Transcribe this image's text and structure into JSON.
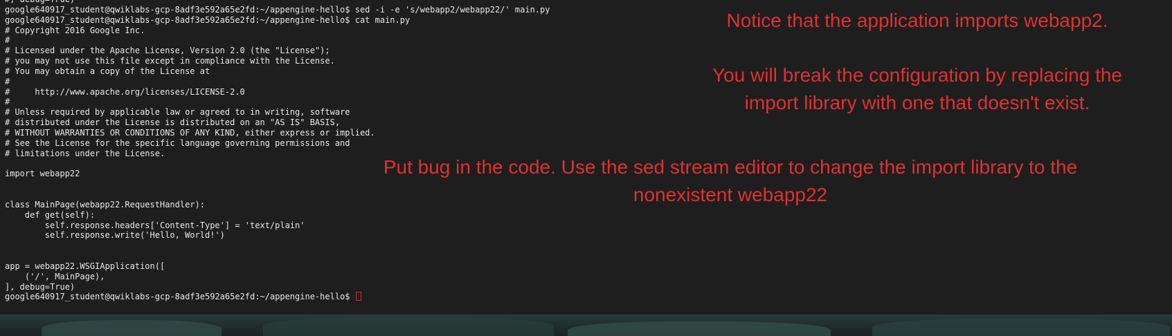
{
  "terminal": {
    "lines": [
      "#, debug=True)",
      "google640917_student@qwiklabs-gcp-8adf3e592a65e2fd:~/appengine-hello$ sed -i -e 's/webapp2/webapp22/' main.py",
      "google640917_student@qwiklabs-gcp-8adf3e592a65e2fd:~/appengine-hello$ cat main.py",
      "# Copyright 2016 Google Inc.",
      "#",
      "# Licensed under the Apache License, Version 2.0 (the \"License\");",
      "# you may not use this file except in compliance with the License.",
      "# You may obtain a copy of the License at",
      "#",
      "#     http://www.apache.org/licenses/LICENSE-2.0",
      "#",
      "# Unless required by applicable law or agreed to in writing, software",
      "# distributed under the License is distributed on an \"AS IS\" BASIS,",
      "# WITHOUT WARRANTIES OR CONDITIONS OF ANY KIND, either express or implied.",
      "# See the License for the specific language governing permissions and",
      "# limitations under the License.",
      "",
      "import webapp22",
      "",
      "",
      "class MainPage(webapp22.RequestHandler):",
      "    def get(self):",
      "        self.response.headers['Content-Type'] = 'text/plain'",
      "        self.response.write('Hello, World!')",
      "",
      "",
      "app = webapp22.WSGIApplication([",
      "    ('/', MainPage),",
      "], debug=True)"
    ],
    "prompt": "google640917_student@qwiklabs-gcp-8adf3e592a65e2fd:~/appengine-hello$ ",
    "cursor_color": "#e22c2c",
    "text_color": "#e8e8e8",
    "background_color": "#1e1e1e"
  },
  "annotations": {
    "color": "#e0312f",
    "note_imports": "Notice that the application imports webapp2.",
    "note_break_line1": "You will break the configuration by replacing the",
    "note_break_line2": "import library with one that doesn't exist.",
    "note_bug_line1": "Put bug in the code. Use the sed stream editor to change the import library to the",
    "note_bug_line2": "nonexistent webapp22"
  }
}
